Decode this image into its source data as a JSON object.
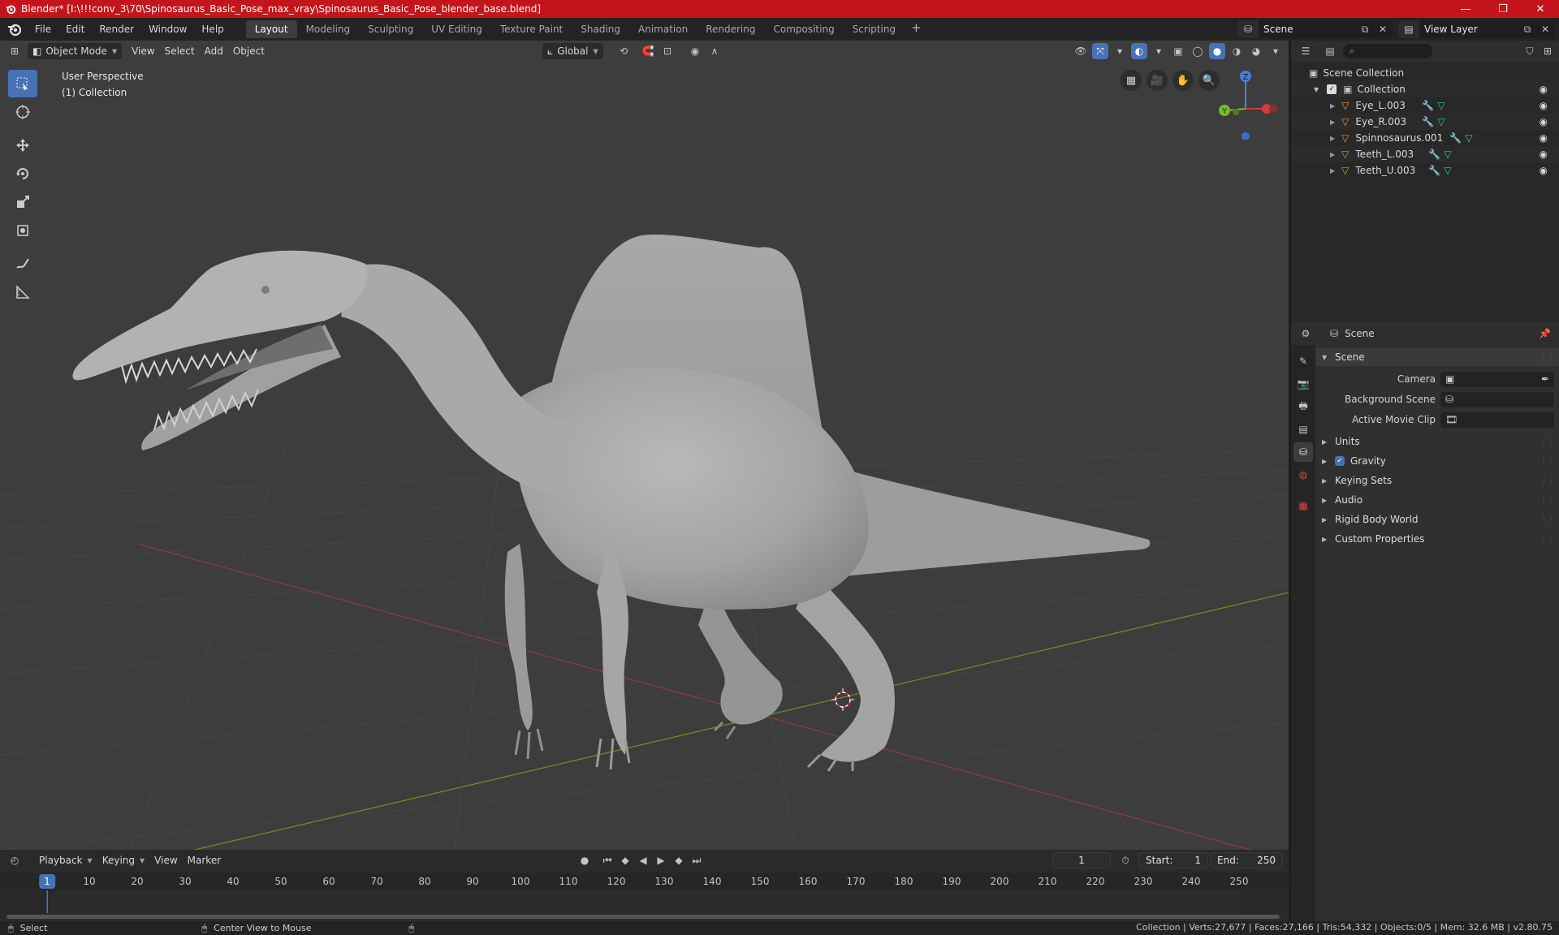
{
  "window": {
    "title": "Blender* [I:\\!!!conv_3\\70\\Spinosaurus_Basic_Pose_max_vray\\Spinosaurus_Basic_Pose_blender_base.blend]",
    "minimize": "—",
    "maximize": "❐",
    "close": "✕"
  },
  "menubar": {
    "items": [
      "File",
      "Edit",
      "Render",
      "Window",
      "Help"
    ],
    "workspaces": [
      "Layout",
      "Modeling",
      "Sculpting",
      "UV Editing",
      "Texture Paint",
      "Shading",
      "Animation",
      "Rendering",
      "Compositing",
      "Scripting"
    ],
    "active_workspace": "Layout",
    "add_workspace": "+",
    "scene_name": "Scene",
    "view_layer": "View Layer"
  },
  "viewport_header": {
    "mode": "Object Mode",
    "menus": [
      "View",
      "Select",
      "Add",
      "Object"
    ],
    "orientation": "Global"
  },
  "viewport": {
    "view_name": "User Perspective",
    "collection_info": "(1) Collection",
    "gizmo": {
      "z": "Z",
      "y": "Y"
    }
  },
  "timeline": {
    "menus": [
      "Playback",
      "Keying",
      "View",
      "Marker"
    ],
    "current_frame": "1",
    "start_label": "Start:",
    "start": "1",
    "end_label": "End:",
    "end": "250",
    "ticks": [
      "10",
      "20",
      "30",
      "40",
      "50",
      "60",
      "70",
      "80",
      "90",
      "100",
      "110",
      "120",
      "130",
      "140",
      "150",
      "160",
      "170",
      "180",
      "190",
      "200",
      "210",
      "220",
      "230",
      "240",
      "250"
    ],
    "ruler_current": "1"
  },
  "statusbar": {
    "left_action": "Select",
    "mid_action": "Center View to Mouse",
    "stats": "Collection | Verts:27,677 | Faces:27,166 | Tris:54,332 | Objects:0/5 | Mem: 32.6 MB | v2.80.75"
  },
  "outliner": {
    "root": "Scene Collection",
    "collection": "Collection",
    "objects": [
      "Eye_L.003",
      "Eye_R.003",
      "Spinnosaurus.001",
      "Teeth_L.003",
      "Teeth_U.003"
    ]
  },
  "properties": {
    "header_title": "Scene",
    "panel": "Scene",
    "fields": [
      {
        "label": "Camera"
      },
      {
        "label": "Background Scene"
      },
      {
        "label": "Active Movie Clip"
      }
    ],
    "subpanels": [
      "Units",
      "Gravity",
      "Keying Sets",
      "Audio",
      "Rigid Body World",
      "Custom Properties"
    ]
  },
  "colors": {
    "accent": "#4772b3",
    "titlebar": "#c4151c",
    "viewport_bg": "#3d3d3d",
    "object_icon": "#e8913a",
    "modifier_icon": "#5a9ee8",
    "mesh_icon": "#31c8a4"
  }
}
